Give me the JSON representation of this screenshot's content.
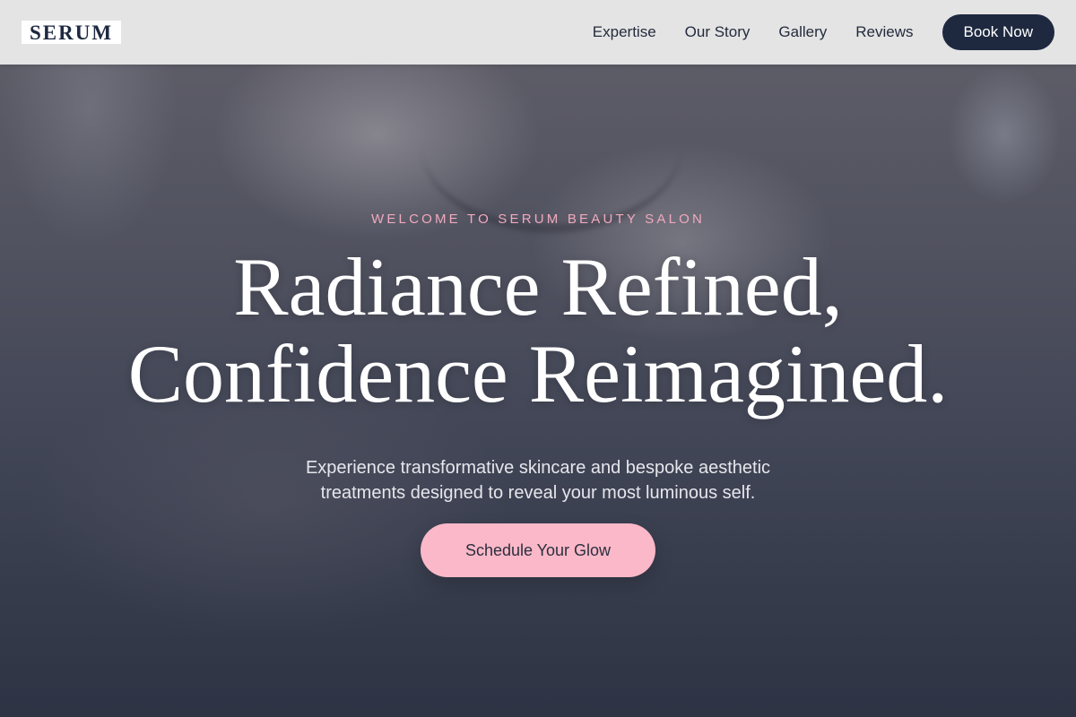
{
  "header": {
    "logo": "SERUM",
    "nav": {
      "expertise": "Expertise",
      "our_story": "Our Story",
      "gallery": "Gallery",
      "reviews": "Reviews"
    },
    "book_now": "Book Now"
  },
  "hero": {
    "eyebrow": "WELCOME TO SERUM BEAUTY SALON",
    "headline_line1": "Radiance Refined,",
    "headline_line2": "Confidence Reimagined.",
    "subtext_line1": "Experience transformative skincare and bespoke aesthetic",
    "subtext_line2": "treatments designed to reveal your most luminous self.",
    "cta": "Schedule Your Glow"
  },
  "colors": {
    "navy": "#1e2940",
    "pink": "#fbb8c8",
    "eyebrow_pink": "#f0a9bd",
    "header_bg": "#e8e8e8"
  }
}
